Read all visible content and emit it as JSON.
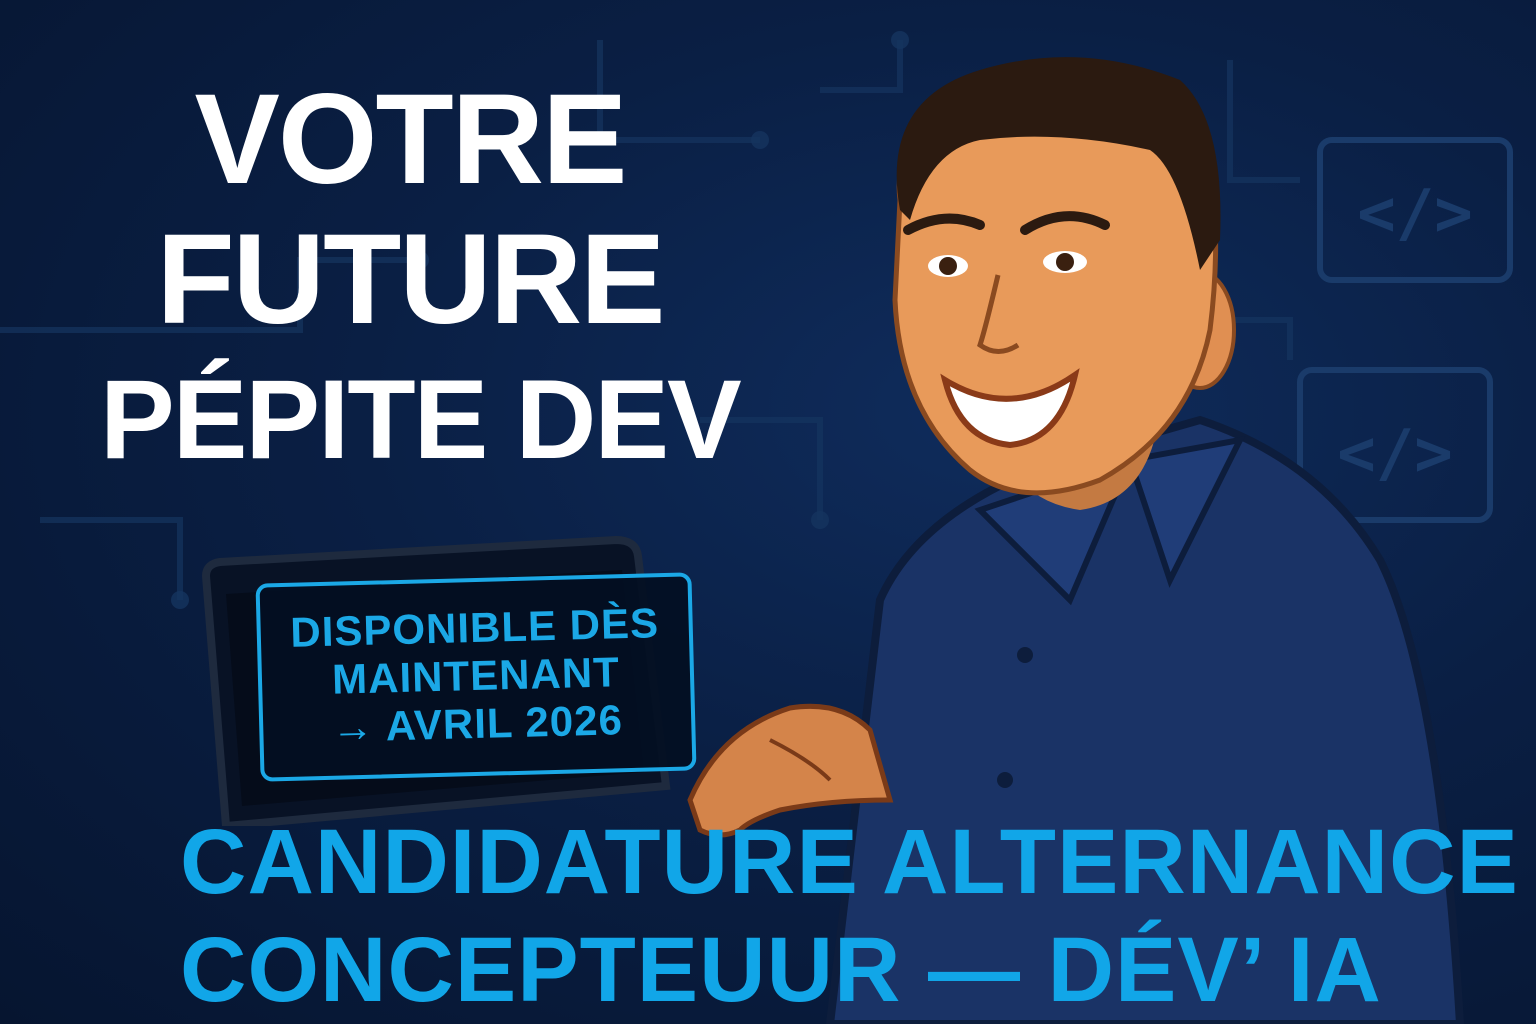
{
  "headline": {
    "line1": "VOTRE",
    "line2": "FUTURE",
    "line3": "PÉPITE DEV"
  },
  "badge": {
    "line1": "DISPONIBLE DÈS",
    "line2": "MAINTENANT",
    "line3": "→ AVRIL 2026"
  },
  "bottom_title": {
    "line1": "CANDIDATURE ALTERNANCE",
    "line2": "CONCEPTEUUR — DÉV’ IA"
  },
  "icons": [
    "code-tag-icon",
    "code-tag-icon"
  ],
  "colors": {
    "background": "#0a1f44",
    "accent": "#11a6e8",
    "headline": "#ffffff",
    "shirt": "#1a3366",
    "skin": "#e89a5a"
  }
}
